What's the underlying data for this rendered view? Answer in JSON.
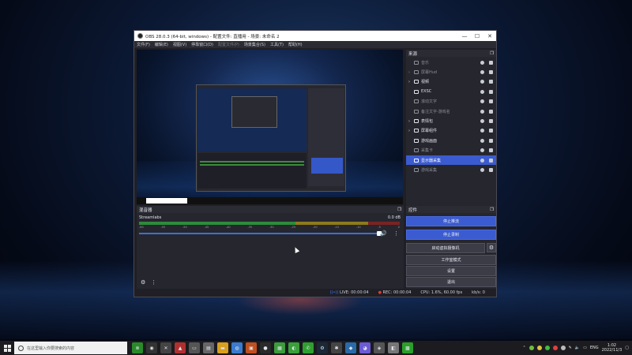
{
  "window": {
    "title": "OBS 28.0.3 (64-bit, windows) - 配置文件: 直播用 - 场景: 未命名 2",
    "controls": {
      "minimize": "—",
      "maximize": "☐",
      "close": "✕"
    }
  },
  "menu": [
    "文件(F)",
    "编辑(E)",
    "视图(V)",
    "停靠窗口(D)",
    "配置文件(P)",
    "场景集合(S)",
    "工具(T)",
    "帮助(H)"
  ],
  "sources": {
    "title": "来源",
    "items": [
      {
        "label": "音乐",
        "dim": true,
        "icon": "image-icon",
        "chev": ""
      },
      {
        "label": "屏幕Hud",
        "dim": true,
        "icon": "folder-icon",
        "chev": "›"
      },
      {
        "label": "视频",
        "dim": false,
        "icon": "folder-icon",
        "chev": "›"
      },
      {
        "label": "EXSC",
        "dim": false,
        "icon": "obs-icon",
        "chev": ""
      },
      {
        "label": "滚动文字",
        "dim": true,
        "icon": "text-icon",
        "chev": ""
      },
      {
        "label": "备注文字-游戏名",
        "dim": true,
        "icon": "text-icon",
        "chev": ""
      },
      {
        "label": "表情包",
        "dim": false,
        "icon": "folder-icon",
        "chev": "›"
      },
      {
        "label": "屏幕组件",
        "dim": false,
        "icon": "folder-icon",
        "chev": "›"
      },
      {
        "label": "游戏画面",
        "dim": false,
        "icon": "gamepad-icon",
        "chev": ""
      },
      {
        "label": "采集卡",
        "dim": true,
        "icon": "camera-icon",
        "chev": ""
      },
      {
        "label": "显示器采集",
        "dim": false,
        "icon": "monitor-icon",
        "chev": "",
        "selected": true
      },
      {
        "label": "游戏采集",
        "dim": true,
        "icon": "gamepad-icon",
        "chev": ""
      }
    ]
  },
  "mixer": {
    "title": "混音器",
    "track": "Streamlabs",
    "db_value": "0.0 dB",
    "ticks": [
      "-60",
      "-55",
      "-50",
      "-45",
      "-40",
      "-35",
      "-30",
      "-25",
      "-20",
      "-15",
      "-10",
      "-5",
      "0"
    ]
  },
  "controls": {
    "title": "控件",
    "buttons": {
      "stop_stream": "停止推流",
      "stop_record": "停止录制",
      "virtual_cam": "启动虚拟摄像机",
      "studio_mode": "工作室模式",
      "settings": "设置",
      "exit": "退出"
    }
  },
  "status": {
    "live": "LIVE: 00:00:04",
    "rec": "REC: 00:00:04",
    "cpu": "CPU: 1.6%, 60.00 fps",
    "kbs": "kb/s: 0"
  },
  "taskbar": {
    "search_placeholder": "在这里输入你要搜索的内容",
    "time": "1:02",
    "date": "2022/11/3",
    "lang": "ENG"
  },
  "colors": {
    "accent": "#3b5bd0",
    "window_bg": "#1f1f25",
    "dock_bg": "#26262e"
  }
}
